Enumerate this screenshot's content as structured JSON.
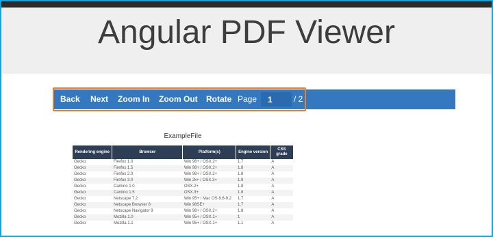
{
  "header": {
    "title": "Angular PDF Viewer"
  },
  "toolbar": {
    "back": "Back",
    "next": "Next",
    "zoom_in": "Zoom In",
    "zoom_out": "Zoom Out",
    "rotate": "Rotate",
    "page_label": "Page",
    "page_value": "1",
    "page_total": "/ 2"
  },
  "document": {
    "title": "ExampleFile",
    "columns": [
      "Rendering engine",
      "Browser",
      "Platform(s)",
      "Engine version",
      "CSS grade"
    ],
    "rows": [
      [
        "Gecko",
        "Firefox 1.0",
        "Win 98+ / OSX.2+",
        "1.7",
        "A"
      ],
      [
        "Gecko",
        "Firefox 1.5",
        "Win 98+ / OSX.2+",
        "1.8",
        "A"
      ],
      [
        "Gecko",
        "Firefox 2.0",
        "Win 98+ / OSX.2+",
        "1.8",
        "A"
      ],
      [
        "Gecko",
        "Firefox 3.0",
        "Win 2k+ / OSX.3+",
        "1.9",
        "A"
      ],
      [
        "Gecko",
        "Camino 1.0",
        "OSX.2+",
        "1.8",
        "A"
      ],
      [
        "Gecko",
        "Camino 1.5",
        "OSX.3+",
        "1.8",
        "A"
      ],
      [
        "Gecko",
        "Netscape 7.2",
        "Win 95+ / Mac OS 8.6-9.2",
        "1.7",
        "A"
      ],
      [
        "Gecko",
        "Netscape Browser 8",
        "Win 98SE+",
        "1.7",
        "A"
      ],
      [
        "Gecko",
        "Netscape Navigator 9",
        "Win 98+ / OSX.2+",
        "1.8",
        "A"
      ],
      [
        "Gecko",
        "Mozilla 1.0",
        "Win 95+ / OSX.1+",
        "1",
        "A"
      ],
      [
        "Gecko",
        "Mozilla 1.1",
        "Win 95+ / OSX.1+",
        "1.1",
        "A"
      ]
    ]
  },
  "colors": {
    "toolbar": "#3478c0",
    "highlight": "#f07d2a",
    "frame_border": "#1aa1d8",
    "table_header": "#2e3e55"
  }
}
